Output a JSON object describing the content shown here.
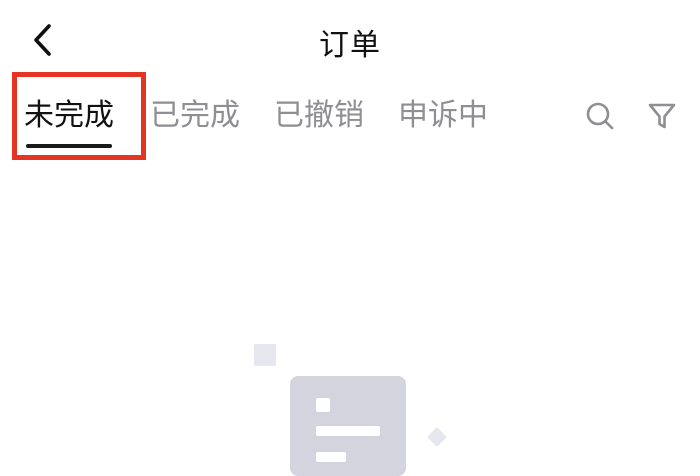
{
  "header": {
    "title": "订单",
    "back_icon": "chevron-left-icon"
  },
  "tabs": [
    {
      "label": "未完成",
      "active": true
    },
    {
      "label": "已完成",
      "active": false
    },
    {
      "label": "已撤销",
      "active": false
    },
    {
      "label": "申诉中",
      "active": false
    }
  ],
  "toolbar": {
    "search_icon": "search-icon",
    "filter_icon": "filter-icon"
  },
  "colors": {
    "highlight": "#e53324",
    "active_text": "#111111",
    "inactive_text": "#8e8e93"
  }
}
